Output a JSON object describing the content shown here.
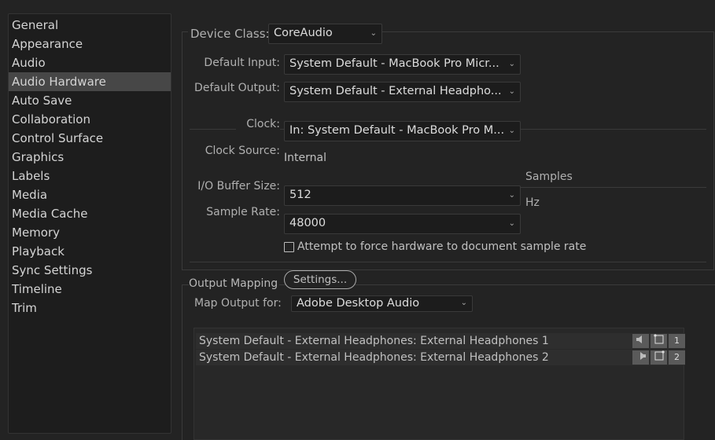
{
  "sidebar": {
    "items": [
      {
        "label": "General"
      },
      {
        "label": "Appearance"
      },
      {
        "label": "Audio"
      },
      {
        "label": "Audio Hardware",
        "selected": true
      },
      {
        "label": "Auto Save"
      },
      {
        "label": "Collaboration"
      },
      {
        "label": "Control Surface"
      },
      {
        "label": "Graphics"
      },
      {
        "label": "Labels"
      },
      {
        "label": "Media"
      },
      {
        "label": "Media Cache"
      },
      {
        "label": "Memory"
      },
      {
        "label": "Playback"
      },
      {
        "label": "Sync Settings"
      },
      {
        "label": "Timeline"
      },
      {
        "label": "Trim"
      }
    ]
  },
  "device": {
    "device_class_label": "Device Class:",
    "device_class": "CoreAudio",
    "default_input_label": "Default Input:",
    "default_input": "System Default - MacBook Pro Micr...",
    "default_output_label": "Default Output:",
    "default_output": "System Default - External Headpho...",
    "clock_label": "Clock:",
    "clock": "In: System Default - MacBook Pro M...",
    "clock_source_label": "Clock Source:",
    "clock_source": "Internal",
    "buffer_label": "I/O Buffer Size:",
    "buffer": "512",
    "buffer_unit": "Samples",
    "sample_rate_label": "Sample Rate:",
    "sample_rate": "48000",
    "sample_rate_unit": "Hz",
    "force_rate_label": "Attempt to force hardware to document sample rate",
    "force_rate_checked": false
  },
  "output_mapping": {
    "title": "Output Mapping",
    "settings_button": "Settings...",
    "map_for_label": "Map Output for:",
    "map_for": "Adobe Desktop Audio",
    "rows": [
      {
        "label": "System Default - External Headphones: External Headphones 1",
        "channel": "1",
        "speaker": "left"
      },
      {
        "label": "System Default - External Headphones: External Headphones 2",
        "channel": "2",
        "speaker": "right"
      }
    ]
  }
}
